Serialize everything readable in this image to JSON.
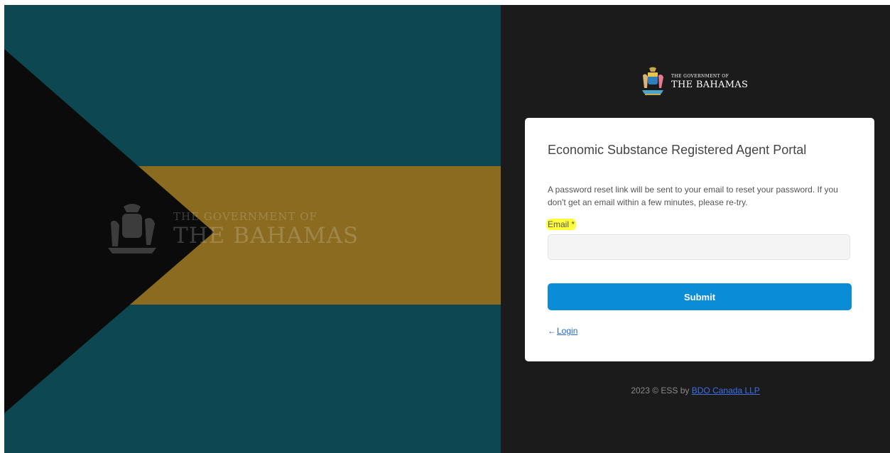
{
  "hero": {
    "watermark_line1": "THE GOVERNMENT OF",
    "watermark_line2": "THE BAHAMAS",
    "colors": {
      "aquamarine": "#0d4751",
      "gold": "#8b6b1f",
      "black": "#0b0b0b"
    }
  },
  "brand": {
    "line1": "THE GOVERNMENT OF",
    "line2": "THE BAHAMAS",
    "logo_icon": "coat-of-arms-icon"
  },
  "card": {
    "title": "Economic Substance Registered Agent Portal",
    "info": "A password reset link will be sent to your email to reset your password. If you don't get an email within a few minutes, please re-try.",
    "email_label": "Email *",
    "email_value": "",
    "submit_label": "Submit",
    "login_arrow": "←",
    "login_label": "Login"
  },
  "footer": {
    "prefix": "2023 © ESS by ",
    "company_link": "BDO Canada LLP"
  },
  "colors": {
    "panel_dark": "#1b1b1b",
    "button_blue": "#0b8cd6",
    "link_blue": "#2266dd",
    "highlight": "#ffff3a"
  }
}
